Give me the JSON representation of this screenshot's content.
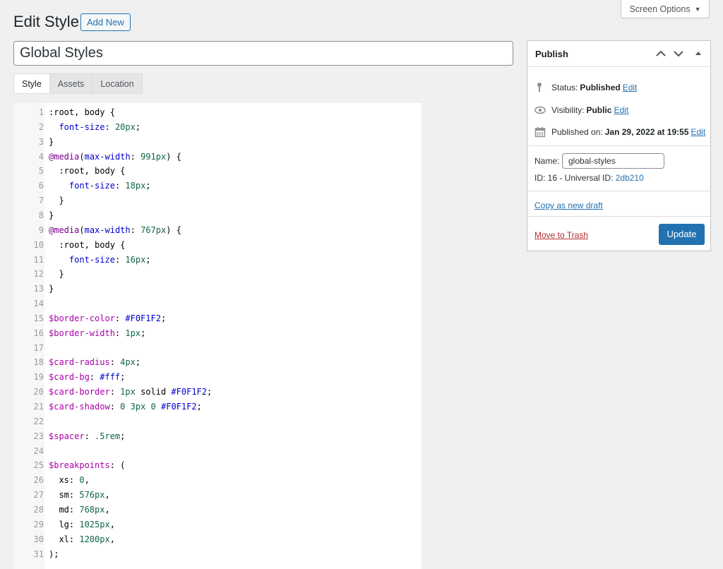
{
  "screen_options": {
    "label": "Screen Options"
  },
  "header": {
    "title": "Edit Style",
    "add_new": "Add New"
  },
  "post_title": "Global Styles",
  "tabs": [
    {
      "label": "Style",
      "active": true
    },
    {
      "label": "Assets",
      "active": false
    },
    {
      "label": "Location",
      "active": false
    }
  ],
  "code_lines": [
    ":root, body {",
    "  font-size: 20px;",
    "}",
    "@media(max-width: 991px) {",
    "  :root, body {",
    "    font-size: 18px;",
    "  }",
    "}",
    "@media(max-width: 767px) {",
    "  :root, body {",
    "    font-size: 16px;",
    "  }",
    "}",
    "",
    "$border-color: #F0F1F2;",
    "$border-width: 1px;",
    "",
    "$card-radius: 4px;",
    "$card-bg: #fff;",
    "$card-border: 1px solid #F0F1F2;",
    "$card-shadow: 0 3px 0 #F0F1F2;",
    "",
    "$spacer: .5rem;",
    "",
    "$breakpoints: (",
    "  xs: 0,",
    "  sm: 576px,",
    "  md: 768px,",
    "  lg: 1025px,",
    "  xl: 1200px,",
    ");"
  ],
  "publish": {
    "title": "Publish",
    "status_label": "Status:",
    "status_value": "Published",
    "visibility_label": "Visibility:",
    "visibility_value": "Public",
    "published_label": "Published on:",
    "published_value": "Jan 29, 2022 at 19:55",
    "edit_label": "Edit",
    "name_label": "Name:",
    "name_value": "global-styles",
    "id_text": "ID: 16 - Universal ID:",
    "universal_id": "2db210",
    "copy_draft": "Copy as new draft",
    "trash": "Move to Trash",
    "update": "Update"
  },
  "colors": {
    "primary": "#2271b1",
    "danger": "#b32d2e",
    "background": "#f0f0f1"
  }
}
